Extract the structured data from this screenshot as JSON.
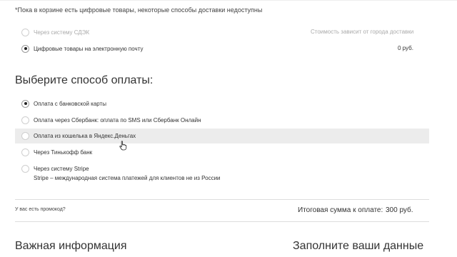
{
  "notice": "*Пока в корзине есть цифровые товары, некоторые способы доставки недоступны",
  "delivery": {
    "options": [
      {
        "label": "Через систему СДЭК",
        "value": "Стоимость зависит от города доставки",
        "selected": false,
        "disabled": true
      },
      {
        "label": "Цифровые товары на электронную почту",
        "value": "0 руб.",
        "selected": true,
        "disabled": false
      }
    ]
  },
  "payment": {
    "title": "Выберите способ оплаты:",
    "options": [
      {
        "label": "Оплата с банковской карты",
        "selected": true
      },
      {
        "label": "Оплата через Сбербанк: оплата по SMS или Сбербанк Онлайн",
        "selected": false
      },
      {
        "label": "Оплата из кошелька в Яндекс.Деньгах",
        "selected": false,
        "hovered": true
      },
      {
        "label": "Через Тинькофф банк",
        "selected": false
      },
      {
        "label": "Через систему Stripe",
        "selected": false,
        "description": "Stripe – международная система платежей для клиентов не из России"
      }
    ]
  },
  "summary": {
    "promo_link": "У вас есть промокод?",
    "total_label": "Итоговая сумма к оплате:",
    "total_value": "300 руб."
  },
  "sections": {
    "important_info": "Важная информация",
    "fill_data": "Заполните ваши данные"
  },
  "colors": {
    "highlight": "#ececec",
    "divider": "#dddddd",
    "disabled_text": "#aaaaaa",
    "text": "#333333"
  }
}
